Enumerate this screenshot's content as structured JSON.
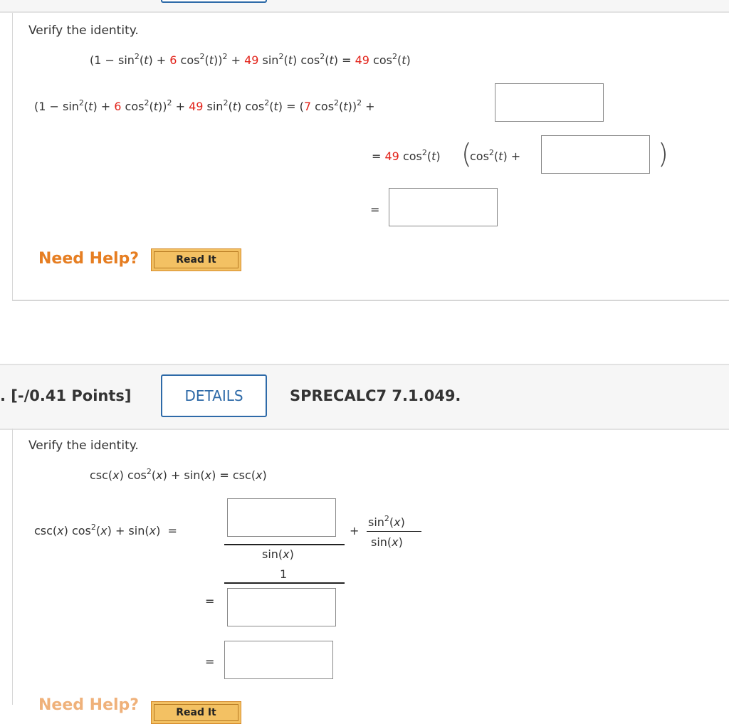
{
  "colors": {
    "accent": "#2e6aa8",
    "highlight": "#e2231a",
    "help": "#e67e22",
    "read_it_bg": "#f3c163"
  },
  "q1": {
    "prompt": "Verify the identity.",
    "identity": [
      [
        "(1 − sin",
        ""
      ],
      [
        "2",
        "s"
      ],
      [
        "(",
        ""
      ],
      [
        "t",
        "i"
      ],
      [
        ") + ",
        ""
      ],
      [
        "6",
        "r"
      ],
      [
        " cos",
        ""
      ],
      [
        "2",
        "s"
      ],
      [
        "(",
        ""
      ],
      [
        "t",
        "i"
      ],
      [
        "))",
        ""
      ],
      [
        "2",
        "s"
      ],
      [
        " + ",
        ""
      ],
      [
        "49",
        "r"
      ],
      [
        " sin",
        ""
      ],
      [
        "2",
        "s"
      ],
      [
        "(",
        ""
      ],
      [
        "t",
        "i"
      ],
      [
        ") cos",
        ""
      ],
      [
        "2",
        "s"
      ],
      [
        "(",
        ""
      ],
      [
        "t",
        "i"
      ],
      [
        ") = ",
        ""
      ],
      [
        "49",
        "r"
      ],
      [
        " cos",
        ""
      ],
      [
        "2",
        "s"
      ],
      [
        "(",
        ""
      ],
      [
        "t",
        "i"
      ],
      [
        ")",
        ""
      ]
    ],
    "lhs": [
      [
        "(1 − sin",
        ""
      ],
      [
        "2",
        "s"
      ],
      [
        "(",
        ""
      ],
      [
        "t",
        "i"
      ],
      [
        ") + ",
        ""
      ],
      [
        "6",
        "r"
      ],
      [
        " cos",
        ""
      ],
      [
        "2",
        "s"
      ],
      [
        "(",
        ""
      ],
      [
        "t",
        "i"
      ],
      [
        "))",
        ""
      ],
      [
        "2",
        "s"
      ],
      [
        " + ",
        ""
      ],
      [
        "49",
        "r"
      ],
      [
        " sin",
        ""
      ],
      [
        "2",
        "s"
      ],
      [
        "(",
        ""
      ],
      [
        "t",
        "i"
      ],
      [
        ") cos",
        ""
      ],
      [
        "2",
        "s"
      ],
      [
        "(",
        ""
      ],
      [
        "t",
        "i"
      ],
      [
        ") = ",
        ""
      ],
      [
        "(",
        ""
      ],
      [
        "7",
        "r"
      ],
      [
        " cos",
        ""
      ],
      [
        "2",
        "s"
      ],
      [
        "(",
        ""
      ],
      [
        "t",
        "i"
      ],
      [
        "))",
        ""
      ],
      [
        "2",
        "s"
      ],
      [
        " +",
        ""
      ]
    ],
    "step2": [
      [
        "= ",
        ""
      ],
      [
        "49",
        "r"
      ],
      [
        " cos",
        ""
      ],
      [
        "2",
        "s"
      ],
      [
        "(",
        ""
      ],
      [
        "t",
        "i"
      ],
      [
        ")",
        ""
      ]
    ],
    "step2_inner": [
      [
        "cos",
        ""
      ],
      [
        "2",
        "s"
      ],
      [
        "(",
        ""
      ],
      [
        "t",
        "i"
      ],
      [
        ") +",
        ""
      ]
    ],
    "step3": [
      [
        "=",
        ""
      ]
    ],
    "answers": [
      "",
      "",
      ""
    ],
    "need_help": "Need Help?",
    "read_it": "Read It"
  },
  "q2": {
    "points": ". [-/0.41 Points]",
    "details": "DETAILS",
    "code": "SPRECALC7 7.1.049.",
    "prompt": "Verify the identity.",
    "identity": [
      [
        "csc(",
        ""
      ],
      [
        "x",
        "i"
      ],
      [
        ") cos",
        ""
      ],
      [
        "2",
        "s"
      ],
      [
        "(",
        ""
      ],
      [
        "x",
        "i"
      ],
      [
        ") + sin(",
        ""
      ],
      [
        "x",
        "i"
      ],
      [
        ") = csc(",
        ""
      ],
      [
        "x",
        "i"
      ],
      [
        ")",
        ""
      ]
    ],
    "lhs": [
      [
        "csc(",
        ""
      ],
      [
        "x",
        "i"
      ],
      [
        ") cos",
        ""
      ],
      [
        "2",
        "s"
      ],
      [
        "(",
        ""
      ],
      [
        "x",
        "i"
      ],
      [
        ") + sin(",
        ""
      ],
      [
        "x",
        "i"
      ],
      [
        ")  =",
        ""
      ]
    ],
    "den1": [
      [
        "sin(",
        ""
      ],
      [
        "x",
        "i"
      ],
      [
        ")",
        ""
      ]
    ],
    "one": [
      [
        "1",
        ""
      ]
    ],
    "plus": [
      [
        "+",
        ""
      ]
    ],
    "num2": [
      [
        "sin",
        ""
      ],
      [
        "2",
        "s"
      ],
      [
        "(",
        ""
      ],
      [
        "x",
        "i"
      ],
      [
        ")",
        ""
      ]
    ],
    "den2": [
      [
        "sin(",
        ""
      ],
      [
        "x",
        "i"
      ],
      [
        ")",
        ""
      ]
    ],
    "eq": [
      [
        "=",
        ""
      ]
    ],
    "answers": [
      "",
      "",
      ""
    ],
    "need_help": "Need Help?",
    "read_it": "Read It"
  },
  "prev_details": "DETAILS"
}
